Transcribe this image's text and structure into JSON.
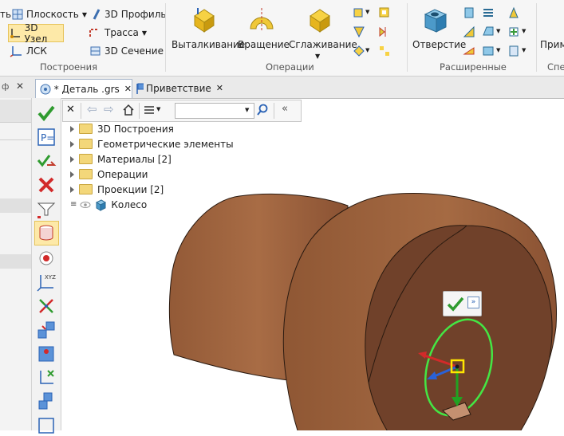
{
  "ribbon": {
    "build": {
      "plane": "Плоскость",
      "profile3d": "3D Профиль",
      "node3d": "3D Узел",
      "route": "Трасса",
      "lcs": "ЛСК",
      "section3d": "3D Сечение",
      "partial_left": "ть",
      "title": "Построения"
    },
    "operations": {
      "extrude": "Выталкивание",
      "rotate": "Вращение",
      "smooth": "Сглаживание",
      "title": "Операции"
    },
    "advanced": {
      "hole": "Отверстие",
      "title": "Расширенные"
    },
    "cut_right": {
      "label": "Прим",
      "title": "Спе"
    }
  },
  "tabs": [
    {
      "label": "* Деталь .grs",
      "active": true
    },
    {
      "label": "Приветствие",
      "active": false
    }
  ],
  "panel_pin": "ф",
  "tree": {
    "search_value": "",
    "items": [
      {
        "label": "3D Построения",
        "icon": "folder-icon"
      },
      {
        "label": "Геометрические элементы",
        "icon": "folder-icon"
      },
      {
        "label": "Материалы [2]",
        "icon": "folder-icon"
      },
      {
        "label": "Операции",
        "icon": "folder-icon"
      },
      {
        "label": "Проекции [2]",
        "icon": "folder-icon"
      },
      {
        "label": "Колесо",
        "icon": "body-icon"
      }
    ]
  },
  "colors": {
    "model": "#8b5534",
    "model_dark": "#6b3f24",
    "accent_green": "#2f9b2f",
    "hole_outline": "#44e644"
  }
}
